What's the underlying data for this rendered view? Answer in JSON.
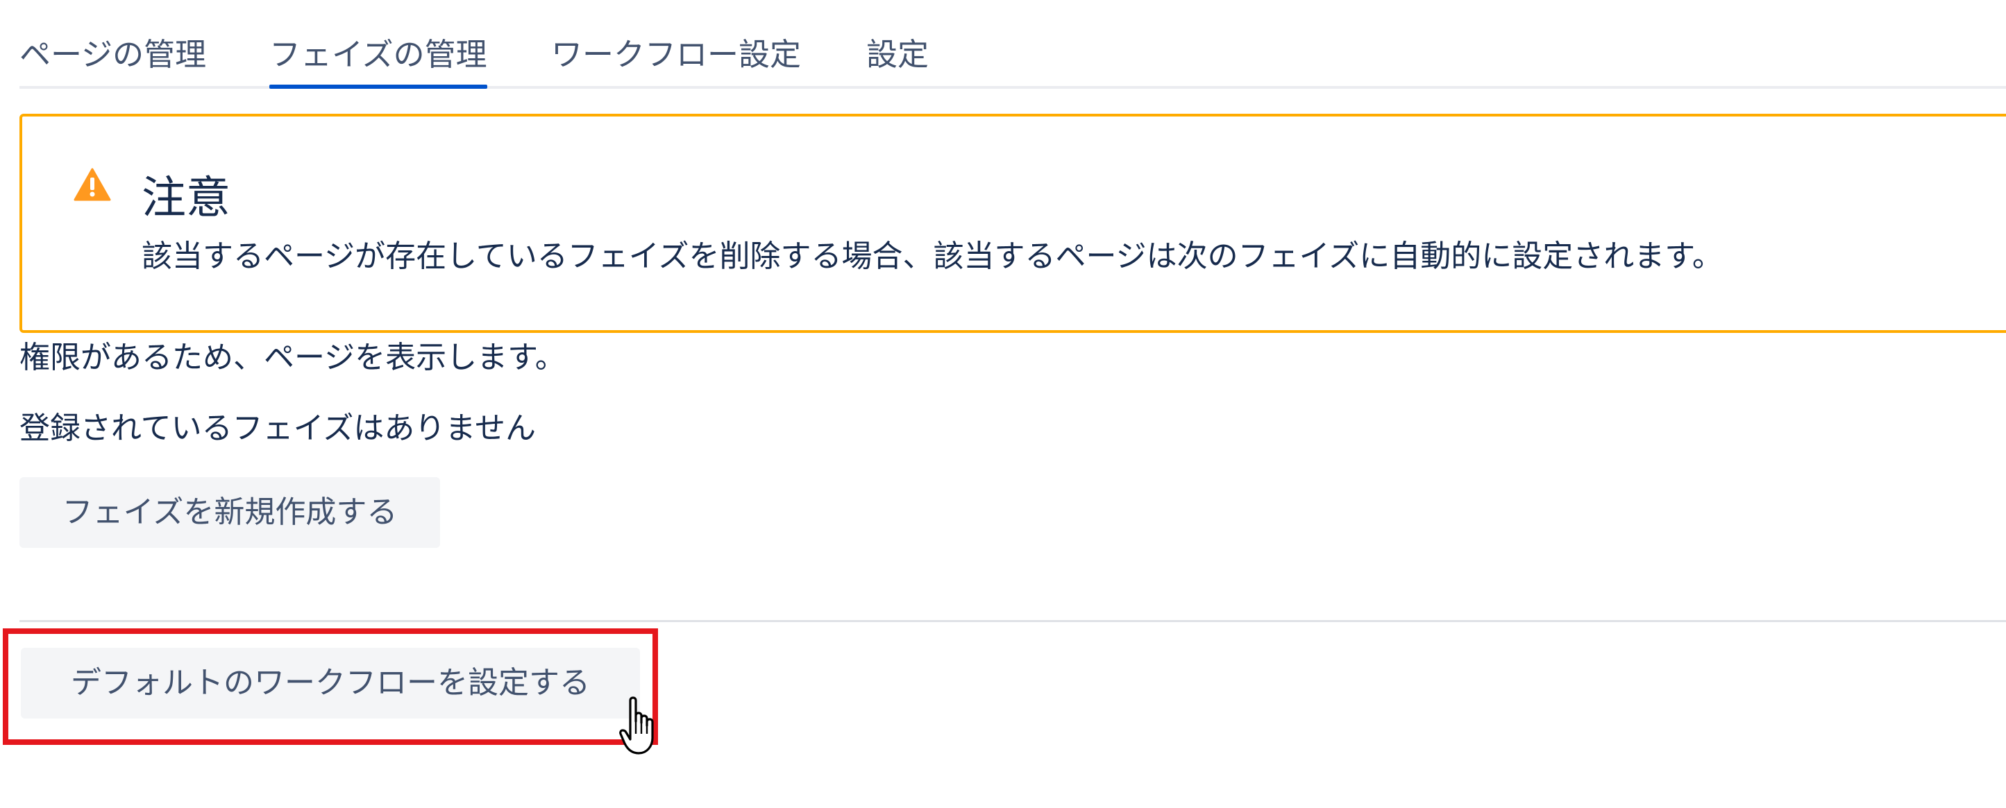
{
  "tabs": {
    "items": [
      {
        "label": "ページの管理"
      },
      {
        "label": "フェイズの管理"
      },
      {
        "label": "ワークフロー設定"
      },
      {
        "label": "設定"
      }
    ],
    "active_index": 1
  },
  "warning": {
    "icon": "warning-triangle-icon",
    "title": "注意",
    "message": "該当するページが存在しているフェイズを削除する場合、該当するページは次のフェイズに自動的に設定されます。",
    "border_color": "#ffab00",
    "icon_color": "#ff991f"
  },
  "content": {
    "permission_text": "権限があるため、ページを表示します。",
    "empty_text": "登録されているフェイズはありません",
    "create_phase_button": "フェイズを新規作成する",
    "default_workflow_button": "デフォルトのワークフローを設定する"
  },
  "annotation": {
    "highlight_color": "#e5171d",
    "cursor": "hand-pointer-icon"
  },
  "colors": {
    "accent": "#0052cc",
    "text": "#172b4d",
    "muted_text": "#42526e",
    "button_bg": "#f4f5f7"
  }
}
